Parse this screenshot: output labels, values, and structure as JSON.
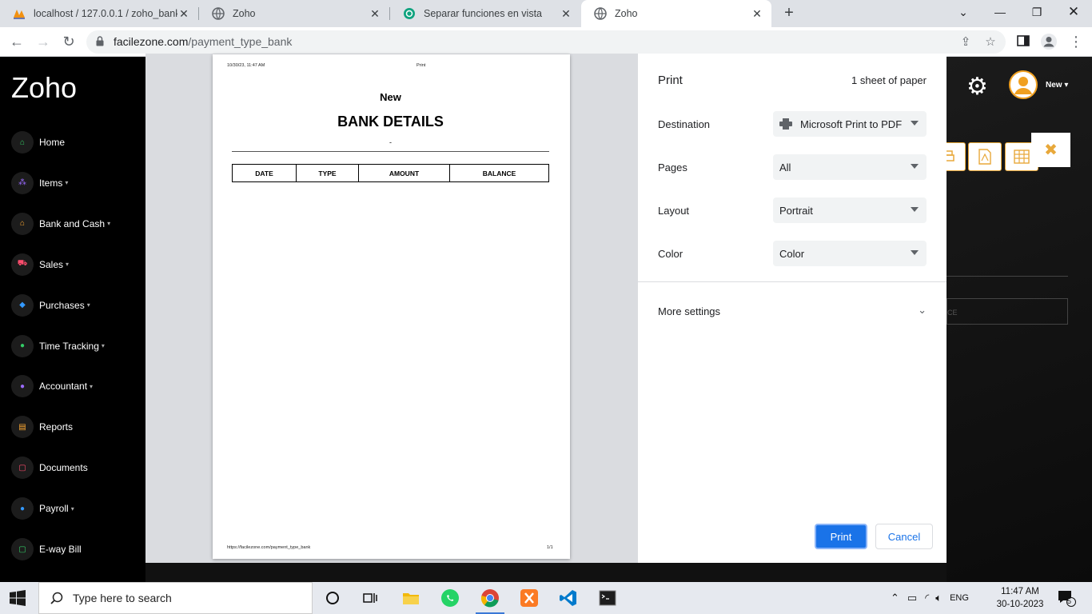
{
  "browser": {
    "tabs": [
      {
        "title": "localhost / 127.0.0.1 / zoho_bank",
        "active": false
      },
      {
        "title": "Zoho",
        "active": false
      },
      {
        "title": "Separar funciones en vista",
        "active": false
      },
      {
        "title": "Zoho",
        "active": true
      }
    ],
    "url_host": "facilezone.com",
    "url_path": "/payment_type_bank"
  },
  "app": {
    "brand": "Zoho",
    "nav": [
      {
        "label": "Home",
        "icon": "home-icon",
        "color": "#33cc66",
        "has_caret": false
      },
      {
        "label": "Items",
        "icon": "items-icon",
        "color": "#9b6bff",
        "has_caret": true
      },
      {
        "label": "Bank and Cash",
        "icon": "bank-icon",
        "color": "#ffaa33",
        "has_caret": true
      },
      {
        "label": "Sales",
        "icon": "cart-icon",
        "color": "#ff4d6d",
        "has_caret": true
      },
      {
        "label": "Purchases",
        "icon": "basket-icon",
        "color": "#3399ff",
        "has_caret": true
      },
      {
        "label": "Time Tracking",
        "icon": "clock-icon",
        "color": "#33cc66",
        "has_caret": true
      },
      {
        "label": "Accountant",
        "icon": "user-icon",
        "color": "#9b6bff",
        "has_caret": true
      },
      {
        "label": "Reports",
        "icon": "report-icon",
        "color": "#ffaa33",
        "has_caret": false
      },
      {
        "label": "Documents",
        "icon": "document-icon",
        "color": "#ff4d6d",
        "has_caret": false
      },
      {
        "label": "Payroll",
        "icon": "payroll-icon",
        "color": "#3399ff",
        "has_caret": true
      },
      {
        "label": "E-way Bill",
        "icon": "eway-icon",
        "color": "#33cc66",
        "has_caret": false
      }
    ],
    "user_label": "New",
    "search_placeholder": "CE"
  },
  "print_dialog": {
    "title": "Print",
    "sheets": "1 sheet of paper",
    "settings": [
      {
        "label": "Destination",
        "value": "Microsoft Print to PDF",
        "has_printer_icon": true
      },
      {
        "label": "Pages",
        "value": "All",
        "has_printer_icon": false
      },
      {
        "label": "Layout",
        "value": "Portrait",
        "has_printer_icon": false
      },
      {
        "label": "Color",
        "value": "Color",
        "has_printer_icon": false
      }
    ],
    "more_settings": "More settings",
    "print_button": "Print",
    "cancel_button": "Cancel",
    "preview": {
      "header_date": "10/30/23, 11:47 AM",
      "header_title": "Print",
      "heading_small": "New",
      "heading": "BANK DETAILS",
      "dash": "-",
      "columns": [
        "DATE",
        "TYPE",
        "AMOUNT",
        "BALANCE"
      ],
      "footer_url": "https://facilezone.com/payment_type_bank",
      "page_number": "1/1"
    }
  },
  "taskbar": {
    "search_placeholder": "Type here to search",
    "language": "ENG",
    "time": "11:47 AM",
    "date": "30-10-2023",
    "notification_count": "5"
  }
}
